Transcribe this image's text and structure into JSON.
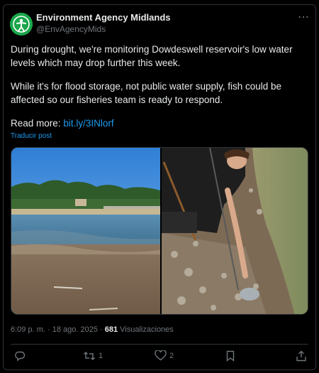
{
  "author": {
    "name": "Environment Agency Midlands",
    "handle": "@EnvAgencyMids"
  },
  "post": {
    "paragraph1": "During drought, we're monitoring Dowdeswell reservoir's low water levels which may drop further this week.",
    "paragraph2": "While it's for flood storage, not public water supply, fish could be affected so our fisheries team is ready to respond.",
    "read_more_label": "Read more:",
    "link": "bit.ly/3INlorf",
    "translate_label": "Traducir post"
  },
  "meta": {
    "time": "6:09 p. m.",
    "separator": "·",
    "date": "18 ago. 2025",
    "views_count": "681",
    "views_label": "Visualizaciones"
  },
  "actions": {
    "reposts": "1",
    "likes": "2"
  },
  "colors": {
    "background": "#000000",
    "link": "#1d9bf0",
    "muted": "#71767b",
    "avatar": "#1aa64b"
  }
}
